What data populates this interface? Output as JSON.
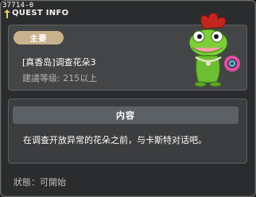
{
  "quest_id": "37714-0",
  "window_title": "QUEST INFO",
  "badge_label": "主要",
  "quest": {
    "name": "[真香岛]调查花朵3",
    "level_requirement": "建議等级: 215以上"
  },
  "content": {
    "header": "内容",
    "description": "在调查开放异常的花朵之前，与卡斯特对话吧。"
  },
  "status_text": "狀態：可開始",
  "icons": {
    "title_icon": "quest-info-icon",
    "npc": "chameleon-npc-icon"
  },
  "colors": {
    "badge": "#c9b18e",
    "content_header": "#5b6165",
    "npc_green": "#7ccf3a",
    "npc_crest": "#c2271d"
  }
}
